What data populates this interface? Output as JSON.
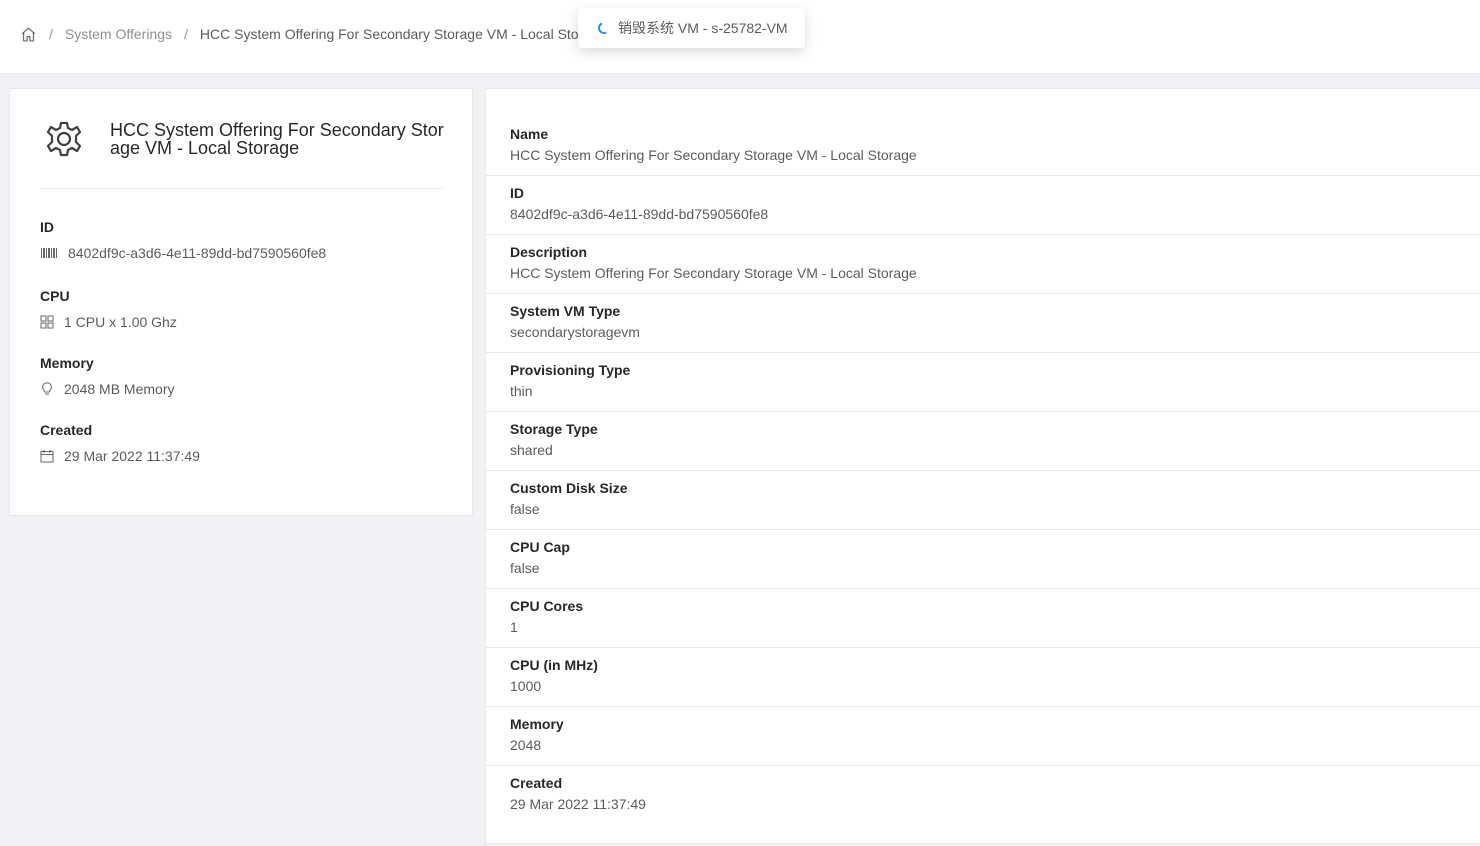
{
  "breadcrumb": {
    "home_icon": "home-icon",
    "separator": "/",
    "items": [
      "System Offerings",
      "HCC System Offering For Secondary Storage VM - Local Storage"
    ]
  },
  "toast": {
    "text": "销毁系统 VM - s-25782-VM",
    "icon": "loading-spinner-icon",
    "accent_color": "#1890ff"
  },
  "summary": {
    "icon": "gear-icon",
    "title": "HCC System Offering For Secondary Storage VM - Local Storage",
    "fields": [
      {
        "label": "ID",
        "value": "8402df9c-a3d6-4e11-89dd-bd7590560fe8",
        "icon": "barcode-icon"
      },
      {
        "label": "CPU",
        "value": "1 CPU x 1.00 Ghz",
        "icon": "appstore-icon"
      },
      {
        "label": "Memory",
        "value": "2048 MB Memory",
        "icon": "bulb-icon"
      },
      {
        "label": "Created",
        "value": "29 Mar 2022 11:37:49",
        "icon": "calendar-icon"
      }
    ]
  },
  "details": [
    {
      "label": "Name",
      "value": "HCC System Offering For Secondary Storage VM - Local Storage"
    },
    {
      "label": "ID",
      "value": "8402df9c-a3d6-4e11-89dd-bd7590560fe8"
    },
    {
      "label": "Description",
      "value": "HCC System Offering For Secondary Storage VM - Local Storage"
    },
    {
      "label": "System VM Type",
      "value": "secondarystoragevm"
    },
    {
      "label": "Provisioning Type",
      "value": "thin"
    },
    {
      "label": "Storage Type",
      "value": "shared"
    },
    {
      "label": "Custom Disk Size",
      "value": "false"
    },
    {
      "label": "CPU Cap",
      "value": "false"
    },
    {
      "label": "CPU Cores",
      "value": "1"
    },
    {
      "label": "CPU (in MHz)",
      "value": "1000"
    },
    {
      "label": "Memory",
      "value": "2048"
    },
    {
      "label": "Created",
      "value": "29 Mar 2022 11:37:49"
    }
  ]
}
